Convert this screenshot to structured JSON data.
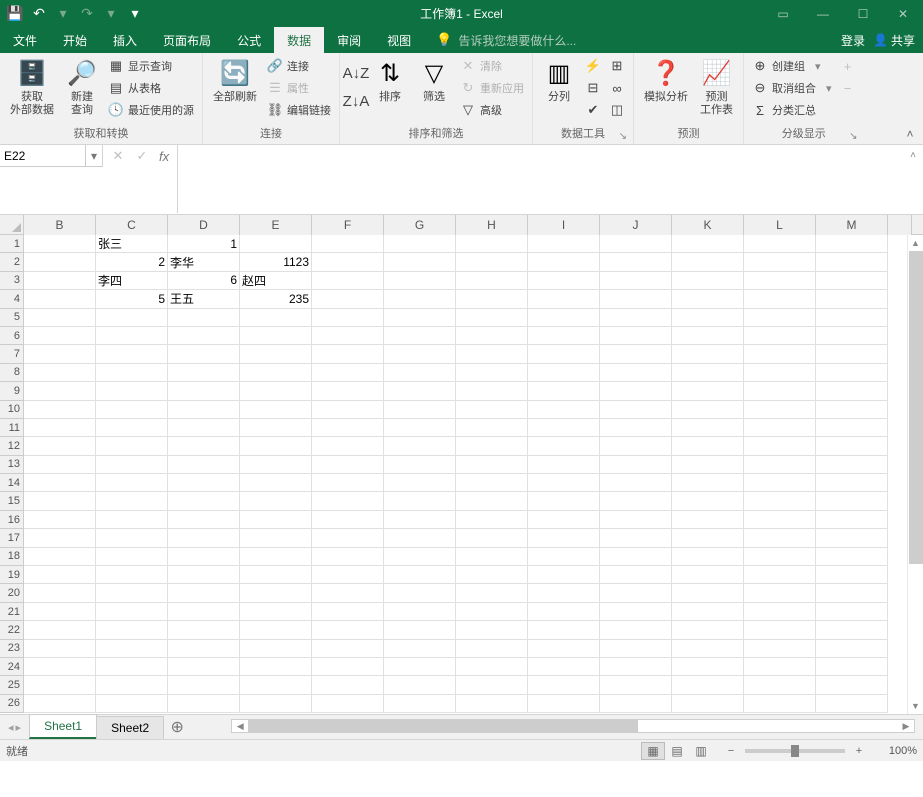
{
  "title": "工作簿1 - Excel",
  "qat": {
    "save": "💾"
  },
  "menu": {
    "file": "文件",
    "home": "开始",
    "insert": "插入",
    "pageLayout": "页面布局",
    "formulas": "公式",
    "data": "数据",
    "review": "审阅",
    "view": "视图",
    "tellMe": "告诉我您想要做什么...",
    "login": "登录",
    "share": "共享"
  },
  "ribbon": {
    "g1": {
      "title": "获取和转换",
      "getExternal": "获取\n外部数据",
      "newQuery": "新建\n查询",
      "showQueries": "显示查询",
      "fromTable": "从表格",
      "recentSources": "最近使用的源"
    },
    "g2": {
      "title": "连接",
      "refreshAll": "全部刷新",
      "connections": "连接",
      "properties": "属性",
      "editLinks": "编辑链接"
    },
    "g3": {
      "title": "排序和筛选",
      "sort": "排序",
      "filter": "筛选",
      "clear": "清除",
      "reapply": "重新应用",
      "advanced": "高级"
    },
    "g4": {
      "title": "数据工具",
      "textToColumns": "分列"
    },
    "g5": {
      "title": "预测",
      "whatIf": "模拟分析",
      "forecast": "预测\n工作表"
    },
    "g6": {
      "title": "分级显示",
      "group": "创建组",
      "ungroup": "取消组合",
      "subtotal": "分类汇总"
    }
  },
  "namebox": "E22",
  "formula": "",
  "columns": [
    "B",
    "C",
    "D",
    "E",
    "F",
    "G",
    "H",
    "I",
    "J",
    "K",
    "L",
    "M"
  ],
  "rowCount": 26,
  "cells": {
    "C1": {
      "v": "张三",
      "t": "s"
    },
    "D1": {
      "v": "1",
      "t": "n"
    },
    "C2": {
      "v": "2",
      "t": "n"
    },
    "D2": {
      "v": "李华",
      "t": "s"
    },
    "E2": {
      "v": "1123",
      "t": "n"
    },
    "C3": {
      "v": "李四",
      "t": "s"
    },
    "D3": {
      "v": "6",
      "t": "n"
    },
    "E3": {
      "v": "赵四",
      "t": "s"
    },
    "C4": {
      "v": "5",
      "t": "n"
    },
    "D4": {
      "v": "王五",
      "t": "s"
    },
    "E4": {
      "v": "235",
      "t": "n"
    }
  },
  "sheets": {
    "active": "Sheet1",
    "list": [
      "Sheet1",
      "Sheet2"
    ]
  },
  "status": {
    "ready": "就绪",
    "zoom": "100%"
  }
}
